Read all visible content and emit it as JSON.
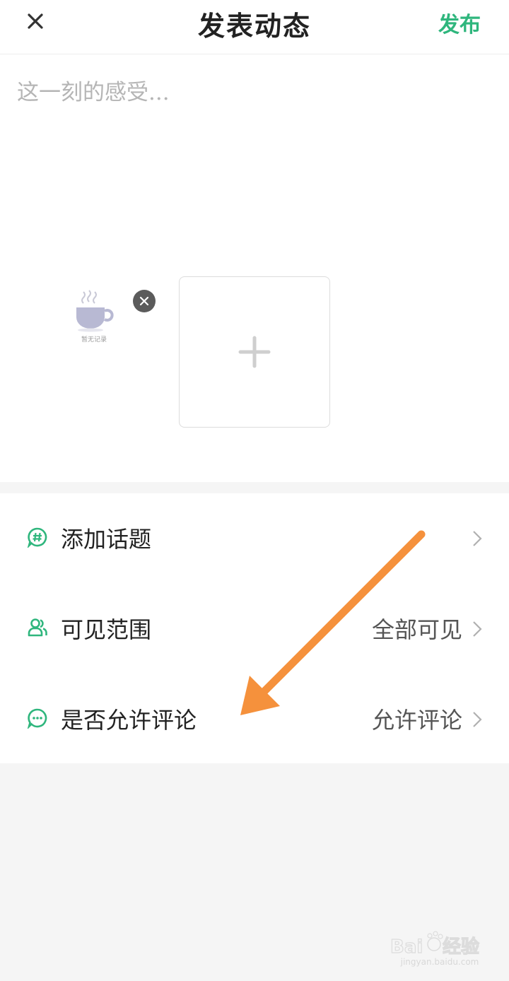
{
  "header": {
    "close_icon": "close-icon",
    "title": "发表动态",
    "publish_label": "发布",
    "accent_color": "#2fb67d"
  },
  "composer": {
    "placeholder": "这一刻的感受...",
    "value": "",
    "attachment": {
      "icon": "coffee-cup-icon",
      "caption": "暂无记录",
      "remove_icon": "close-circle-icon"
    },
    "add_image_icon": "plus-icon"
  },
  "options": [
    {
      "icon": "hashtag-bubble-icon",
      "label": "添加话题",
      "value": ""
    },
    {
      "icon": "people-icon",
      "label": "可见范围",
      "value": "全部可见"
    },
    {
      "icon": "chat-dots-icon",
      "label": "是否允许评论",
      "value": "允许评论"
    }
  ],
  "annotation": {
    "icon": "orange-arrow-icon",
    "color": "#f5913c"
  },
  "watermark": {
    "logo_text": "Baidu经验",
    "url": "jingyan.baidu.com"
  }
}
